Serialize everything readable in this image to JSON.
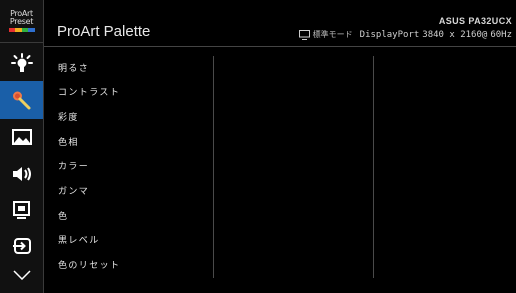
{
  "logo": {
    "line1": "ProArt",
    "line2": "Preset"
  },
  "sidebar": {
    "items": [
      {
        "name": "brightness-icon",
        "active": false
      },
      {
        "name": "palette-icon",
        "active": true
      },
      {
        "name": "image-icon",
        "active": false
      },
      {
        "name": "sound-icon",
        "active": false
      },
      {
        "name": "pip-icon",
        "active": false
      },
      {
        "name": "input-select-icon",
        "active": false
      },
      {
        "name": "chevron-down-icon",
        "active": false
      }
    ]
  },
  "header": {
    "title": "ProArt Palette",
    "model": "ASUS PA32UCX",
    "mode_label": "標準モード",
    "input": "DisplayPort",
    "resolution": "3840 x 2160@",
    "refresh": "60Hz"
  },
  "menu": {
    "items": [
      "明るさ",
      "コントラスト",
      "彩度",
      "色相",
      "カラー",
      "ガンマ",
      "色",
      "黒レベル",
      "色のリセット"
    ]
  },
  "colors": {
    "accent": "#1a5fa8",
    "background": "#000000",
    "sidebar": "#111111"
  }
}
